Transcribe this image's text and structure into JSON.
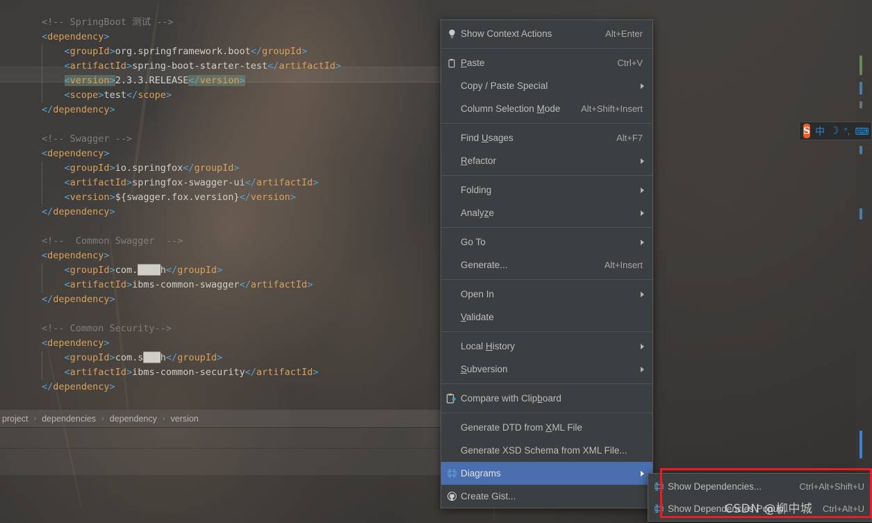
{
  "colors": {
    "menu_bg": "#3c3f41",
    "menu_border": "#5a5d5f",
    "menu_text": "#bbbbbb",
    "separator": "#4f5355",
    "highlight": "#4b6eaf",
    "annotation_red": "#ec1c24",
    "xml_tag": "#5ba2d0",
    "xml_tagname": "#d9a05b",
    "comment": "#7f7e7a",
    "text_value": "#cfcfc7",
    "selection_green": "rgba(117,151,124,0.45)",
    "ime_orange": "#f05a23",
    "ime_blue": "#1f8ce0"
  },
  "editor": {
    "lines": [
      {
        "indent": 1,
        "parts": [
          {
            "t": "cmt",
            "v": "<!-- SpringBoot 测试 -->"
          }
        ]
      },
      {
        "indent": 1,
        "parts": [
          {
            "t": "tag",
            "v": "<"
          },
          {
            "t": "tagname",
            "v": "dependency"
          },
          {
            "t": "tag",
            "v": ">"
          }
        ]
      },
      {
        "indent": 2,
        "parts": [
          {
            "t": "tag",
            "v": "<"
          },
          {
            "t": "tagname",
            "v": "groupId"
          },
          {
            "t": "tag",
            "v": ">"
          },
          {
            "t": "txt",
            "v": "org.springframework.boot"
          },
          {
            "t": "tag",
            "v": "</"
          },
          {
            "t": "tagname",
            "v": "groupId"
          },
          {
            "t": "tag",
            "v": ">"
          }
        ]
      },
      {
        "indent": 2,
        "parts": [
          {
            "t": "tag",
            "v": "<"
          },
          {
            "t": "tagname",
            "v": "artifactId"
          },
          {
            "t": "tag",
            "v": ">"
          },
          {
            "t": "txt",
            "v": "spring-boot-starter-test"
          },
          {
            "t": "tag",
            "v": "</"
          },
          {
            "t": "tagname",
            "v": "artifactId"
          },
          {
            "t": "tag",
            "v": ">"
          }
        ]
      },
      {
        "indent": 2,
        "selected": true,
        "parts": [
          {
            "t": "tag hl",
            "v": "<"
          },
          {
            "t": "tagname hl",
            "v": "version"
          },
          {
            "t": "tag hl",
            "v": ">"
          },
          {
            "t": "txt",
            "v": "2.3.3.RELEASE"
          },
          {
            "t": "tag hl",
            "v": "</"
          },
          {
            "t": "tagname hl",
            "v": "version"
          },
          {
            "t": "tag hl",
            "v": ">"
          }
        ]
      },
      {
        "indent": 2,
        "parts": [
          {
            "t": "tag",
            "v": "<"
          },
          {
            "t": "tagname",
            "v": "scope"
          },
          {
            "t": "tag",
            "v": ">"
          },
          {
            "t": "txt",
            "v": "test"
          },
          {
            "t": "tag",
            "v": "</"
          },
          {
            "t": "tagname",
            "v": "scope"
          },
          {
            "t": "tag",
            "v": ">"
          }
        ]
      },
      {
        "indent": 1,
        "parts": [
          {
            "t": "tag",
            "v": "</"
          },
          {
            "t": "tagname",
            "v": "dependency"
          },
          {
            "t": "tag",
            "v": ">"
          }
        ]
      },
      {
        "indent": 1,
        "parts": []
      },
      {
        "indent": 1,
        "parts": [
          {
            "t": "cmt",
            "v": "<!-- Swagger -->"
          }
        ]
      },
      {
        "indent": 1,
        "parts": [
          {
            "t": "tag",
            "v": "<"
          },
          {
            "t": "tagname",
            "v": "dependency"
          },
          {
            "t": "tag",
            "v": ">"
          }
        ]
      },
      {
        "indent": 2,
        "parts": [
          {
            "t": "tag",
            "v": "<"
          },
          {
            "t": "tagname",
            "v": "groupId"
          },
          {
            "t": "tag",
            "v": ">"
          },
          {
            "t": "txt",
            "v": "io.springfox"
          },
          {
            "t": "tag",
            "v": "</"
          },
          {
            "t": "tagname",
            "v": "groupId"
          },
          {
            "t": "tag",
            "v": ">"
          }
        ]
      },
      {
        "indent": 2,
        "parts": [
          {
            "t": "tag",
            "v": "<"
          },
          {
            "t": "tagname",
            "v": "artifactId"
          },
          {
            "t": "tag",
            "v": ">"
          },
          {
            "t": "txt",
            "v": "springfox-swagger-ui"
          },
          {
            "t": "tag",
            "v": "</"
          },
          {
            "t": "tagname",
            "v": "artifactId"
          },
          {
            "t": "tag",
            "v": ">"
          }
        ]
      },
      {
        "indent": 2,
        "parts": [
          {
            "t": "tag",
            "v": "<"
          },
          {
            "t": "tagname",
            "v": "version"
          },
          {
            "t": "tag",
            "v": ">"
          },
          {
            "t": "txt",
            "v": "${swagger.fox.version}"
          },
          {
            "t": "tag",
            "v": "</"
          },
          {
            "t": "tagname",
            "v": "version"
          },
          {
            "t": "tag",
            "v": ">"
          }
        ]
      },
      {
        "indent": 1,
        "parts": [
          {
            "t": "tag",
            "v": "</"
          },
          {
            "t": "tagname",
            "v": "dependency"
          },
          {
            "t": "tag",
            "v": ">"
          }
        ]
      },
      {
        "indent": 1,
        "parts": []
      },
      {
        "indent": 1,
        "parts": [
          {
            "t": "cmt",
            "v": "<!--  Common Swagger  -->"
          }
        ]
      },
      {
        "indent": 1,
        "parts": [
          {
            "t": "tag",
            "v": "<"
          },
          {
            "t": "tagname",
            "v": "dependency"
          },
          {
            "t": "tag",
            "v": ">"
          }
        ]
      },
      {
        "indent": 2,
        "parts": [
          {
            "t": "tag",
            "v": "<"
          },
          {
            "t": "tagname",
            "v": "groupId"
          },
          {
            "t": "tag",
            "v": ">"
          },
          {
            "t": "txt",
            "v": "com.████h"
          },
          {
            "t": "tag",
            "v": "</"
          },
          {
            "t": "tagname",
            "v": "groupId"
          },
          {
            "t": "tag",
            "v": ">"
          }
        ]
      },
      {
        "indent": 2,
        "parts": [
          {
            "t": "tag",
            "v": "<"
          },
          {
            "t": "tagname",
            "v": "artifactId"
          },
          {
            "t": "tag",
            "v": ">"
          },
          {
            "t": "txt",
            "v": "ibms-common-swagger"
          },
          {
            "t": "tag",
            "v": "</"
          },
          {
            "t": "tagname",
            "v": "artifactId"
          },
          {
            "t": "tag",
            "v": ">"
          }
        ]
      },
      {
        "indent": 1,
        "parts": [
          {
            "t": "tag",
            "v": "</"
          },
          {
            "t": "tagname",
            "v": "dependency"
          },
          {
            "t": "tag",
            "v": ">"
          }
        ]
      },
      {
        "indent": 1,
        "parts": []
      },
      {
        "indent": 1,
        "parts": [
          {
            "t": "cmt",
            "v": "<!-- Common Security-->"
          }
        ]
      },
      {
        "indent": 1,
        "parts": [
          {
            "t": "tag",
            "v": "<"
          },
          {
            "t": "tagname",
            "v": "dependency"
          },
          {
            "t": "tag",
            "v": ">"
          }
        ]
      },
      {
        "indent": 2,
        "parts": [
          {
            "t": "tag",
            "v": "<"
          },
          {
            "t": "tagname",
            "v": "groupId"
          },
          {
            "t": "tag",
            "v": ">"
          },
          {
            "t": "txt",
            "v": "com.s███h"
          },
          {
            "t": "tag",
            "v": "</"
          },
          {
            "t": "tagname",
            "v": "groupId"
          },
          {
            "t": "tag",
            "v": ">"
          }
        ]
      },
      {
        "indent": 2,
        "parts": [
          {
            "t": "tag",
            "v": "<"
          },
          {
            "t": "tagname",
            "v": "artifactId"
          },
          {
            "t": "tag",
            "v": ">"
          },
          {
            "t": "txt",
            "v": "ibms-common-security"
          },
          {
            "t": "tag",
            "v": "</"
          },
          {
            "t": "tagname",
            "v": "artifactId"
          },
          {
            "t": "tag",
            "v": ">"
          }
        ]
      },
      {
        "indent": 1,
        "parts": [
          {
            "t": "tag",
            "v": "</"
          },
          {
            "t": "tagname",
            "v": "dependency"
          },
          {
            "t": "tag",
            "v": ">"
          }
        ]
      }
    ]
  },
  "breadcrumb": {
    "items": [
      "project",
      "dependencies",
      "dependency",
      "version"
    ],
    "separator": "›"
  },
  "context_menu": {
    "items": [
      {
        "label": "Show Context Actions",
        "accel": "Alt+Enter",
        "icon": "lightbulb-icon",
        "mnemonic": "",
        "arrow": false
      },
      {
        "sep": true
      },
      {
        "label": "Paste",
        "accel": "Ctrl+V",
        "icon": "clipboard-icon",
        "mnemonic": "P",
        "arrow": false
      },
      {
        "label": "Copy / Paste Special",
        "accel": "",
        "icon": "",
        "mnemonic": "",
        "arrow": true
      },
      {
        "label": "Column Selection Mode",
        "accel": "Alt+Shift+Insert",
        "icon": "",
        "mnemonic": "M",
        "arrow": false
      },
      {
        "sep": true
      },
      {
        "label": "Find Usages",
        "accel": "Alt+F7",
        "icon": "",
        "mnemonic": "U",
        "arrow": false
      },
      {
        "label": "Refactor",
        "accel": "",
        "icon": "",
        "mnemonic": "R",
        "arrow": true
      },
      {
        "sep": true
      },
      {
        "label": "Folding",
        "accel": "",
        "icon": "",
        "mnemonic": "",
        "arrow": true
      },
      {
        "label": "Analyze",
        "accel": "",
        "icon": "",
        "mnemonic": "z",
        "arrow": true
      },
      {
        "sep": true
      },
      {
        "label": "Go To",
        "accel": "",
        "icon": "",
        "mnemonic": "",
        "arrow": true
      },
      {
        "label": "Generate...",
        "accel": "Alt+Insert",
        "icon": "",
        "mnemonic": "",
        "arrow": false
      },
      {
        "sep": true
      },
      {
        "label": "Open In",
        "accel": "",
        "icon": "",
        "mnemonic": "",
        "arrow": true
      },
      {
        "label": "Validate",
        "accel": "",
        "icon": "",
        "mnemonic": "V",
        "arrow": false
      },
      {
        "sep": true
      },
      {
        "label": "Local History",
        "accel": "",
        "icon": "",
        "mnemonic": "H",
        "arrow": true
      },
      {
        "label": "Subversion",
        "accel": "",
        "icon": "",
        "mnemonic": "S",
        "arrow": true
      },
      {
        "sep": true
      },
      {
        "label": "Compare with Clipboard",
        "accel": "",
        "icon": "compare-clipboard-icon",
        "mnemonic": "b",
        "arrow": false
      },
      {
        "sep": true
      },
      {
        "label": "Generate DTD from XML File",
        "accel": "",
        "icon": "",
        "mnemonic": "X",
        "arrow": false
      },
      {
        "label": "Generate XSD Schema from XML File...",
        "accel": "",
        "icon": "",
        "mnemonic": "",
        "arrow": false
      },
      {
        "label": "Diagrams",
        "accel": "",
        "icon": "diagram-icon",
        "mnemonic": "",
        "arrow": true,
        "selected": true
      },
      {
        "label": "Create Gist...",
        "accel": "",
        "icon": "github-icon",
        "mnemonic": "",
        "arrow": false
      }
    ]
  },
  "submenu": {
    "items": [
      {
        "label": "Show Dependencies...",
        "accel": "Ctrl+Alt+Shift+U",
        "icon": "diagram-icon"
      },
      {
        "label": "Show Dependencies Popup...",
        "accel": "Ctrl+Alt+U",
        "icon": "diagram-icon"
      }
    ]
  },
  "ime": {
    "logo": "S",
    "mode": "中",
    "moon": "☽",
    "punct": "°,",
    "keyboard": "⌨"
  },
  "watermark": "CSDN @柳中城"
}
